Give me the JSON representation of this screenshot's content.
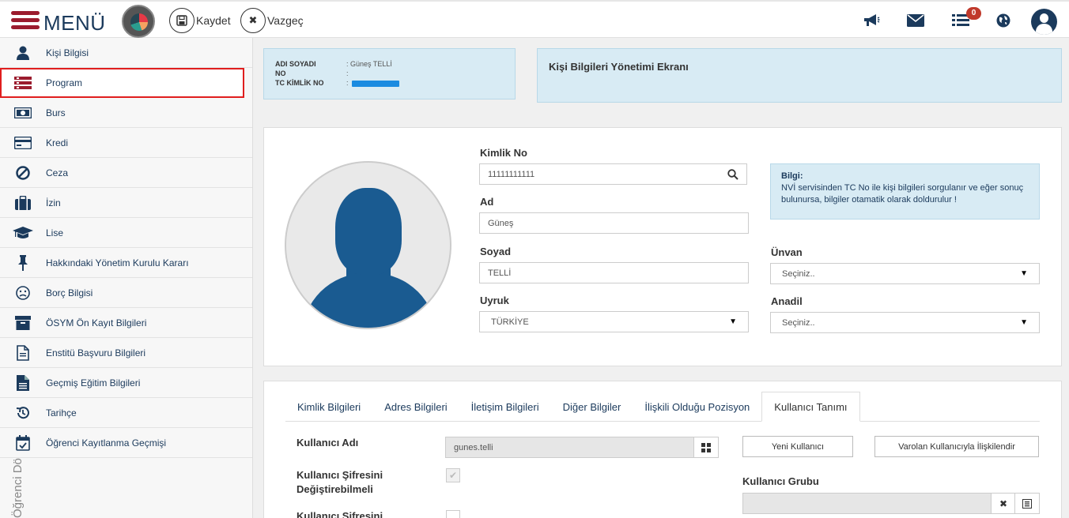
{
  "header": {
    "menu_label": "MENÜ",
    "save_label": "Kaydet",
    "cancel_label": "Vazgeç",
    "notification_count": "0"
  },
  "sidebar": {
    "items": [
      {
        "label": "Kişi Bilgisi",
        "icon": "user-icon"
      },
      {
        "label": "Program",
        "icon": "list-icon"
      },
      {
        "label": "Burs",
        "icon": "money-icon"
      },
      {
        "label": "Kredi",
        "icon": "credit-card-icon"
      },
      {
        "label": "Ceza",
        "icon": "ban-icon"
      },
      {
        "label": "İzin",
        "icon": "briefcase-icon"
      },
      {
        "label": "Lise",
        "icon": "graduation-cap-icon"
      },
      {
        "label": "Hakkındaki Yönetim Kurulu Kararı",
        "icon": "pin-icon"
      },
      {
        "label": "Borç Bilgisi",
        "icon": "frown-icon"
      },
      {
        "label": "ÖSYM Ön Kayıt Bilgileri",
        "icon": "archive-icon"
      },
      {
        "label": "Enstitü Başvuru Bilgileri",
        "icon": "file-icon"
      },
      {
        "label": "Geçmiş Eğitim Bilgileri",
        "icon": "file-text-icon"
      },
      {
        "label": "Tarihçe",
        "icon": "history-icon"
      },
      {
        "label": "Öğrenci Kayıtlanma Geçmişi",
        "icon": "calendar-check-icon"
      }
    ],
    "vertical_text": "Öğrenci Dö"
  },
  "person_info": {
    "name_label": "ADI SOYADI",
    "name_value": ": Güneş TELLİ",
    "no_label": "NO",
    "no_value": ":",
    "tc_label": "TC KİMLİK NO",
    "tc_value": ":"
  },
  "page_title": "Kişi Bilgileri Yönetimi Ekranı",
  "form": {
    "kimlik_label": "Kimlik No",
    "kimlik_value": "11111111111",
    "ad_label": "Ad",
    "ad_value": "Güneş",
    "soyad_label": "Soyad",
    "soyad_value": "TELLİ",
    "uyruk_label": "Uyruk",
    "uyruk_value": "TÜRKİYE",
    "unvan_label": "Ünvan",
    "unvan_value": "Seçiniz..",
    "anadil_label": "Anadil",
    "anadil_value": "Seçiniz..",
    "info_title": "Bilgi:",
    "info_text": "NVİ servisinden TC No ile kişi bilgileri sorgulanır ve eğer sonuç bulunursa, bilgiler otamatik olarak doldurulur !"
  },
  "tabs": [
    {
      "label": "Kimlik Bilgileri"
    },
    {
      "label": "Adres Bilgileri"
    },
    {
      "label": "İletişim Bilgileri"
    },
    {
      "label": "Diğer Bilgiler"
    },
    {
      "label": "İlişkili Olduğu Pozisyon"
    },
    {
      "label": "Kullanıcı Tanımı"
    }
  ],
  "user_def": {
    "username_label": "Kullanıcı Adı",
    "username_value": "gunes.telli",
    "new_user_label": "Yeni Kullanıcı",
    "link_user_label": "Varolan Kullanıcıyla İlişkilendir",
    "can_change_label_1": "Kullanıcı Şifresini",
    "can_change_label_2": "Değiştirebilmeli",
    "user_group_label": "Kullanıcı Grubu",
    "password_label_cut": "Kullanıcı Şifresini"
  }
}
